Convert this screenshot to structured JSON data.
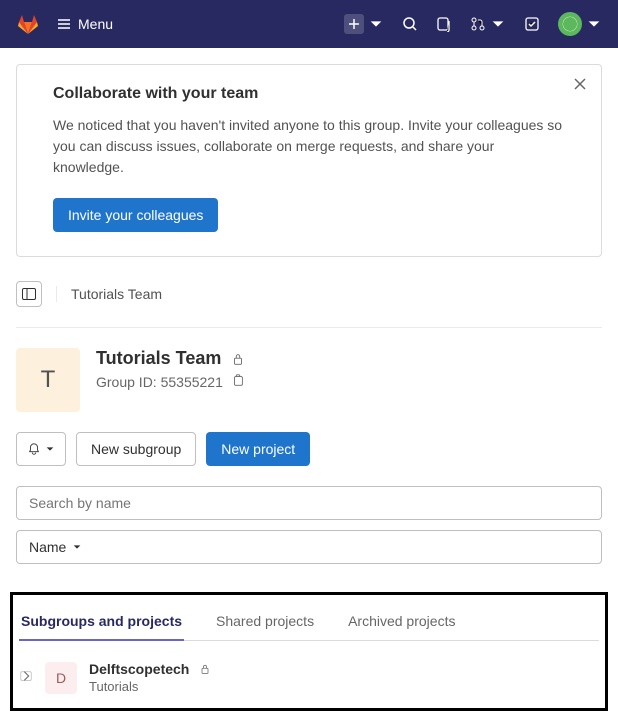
{
  "header": {
    "menu_label": "Menu"
  },
  "collab": {
    "title": "Collaborate with your team",
    "body": "We noticed that you haven't invited anyone to this group. Invite your colleagues so you can discuss issues, collaborate on merge requests, and share your knowledge.",
    "button": "Invite your colleagues"
  },
  "breadcrumb": {
    "text": "Tutorials Team"
  },
  "group": {
    "avatar_letter": "T",
    "name": "Tutorials Team",
    "id_label": "Group ID: 55355221"
  },
  "actions": {
    "new_subgroup": "New subgroup",
    "new_project": "New project"
  },
  "search": {
    "placeholder": "Search by name"
  },
  "sort": {
    "label": "Name"
  },
  "tabs": {
    "subgroups": "Subgroups and projects",
    "shared": "Shared projects",
    "archived": "Archived projects"
  },
  "project": {
    "avatar_letter": "D",
    "name": "Delftscopetech",
    "subtitle": "Tutorials"
  }
}
